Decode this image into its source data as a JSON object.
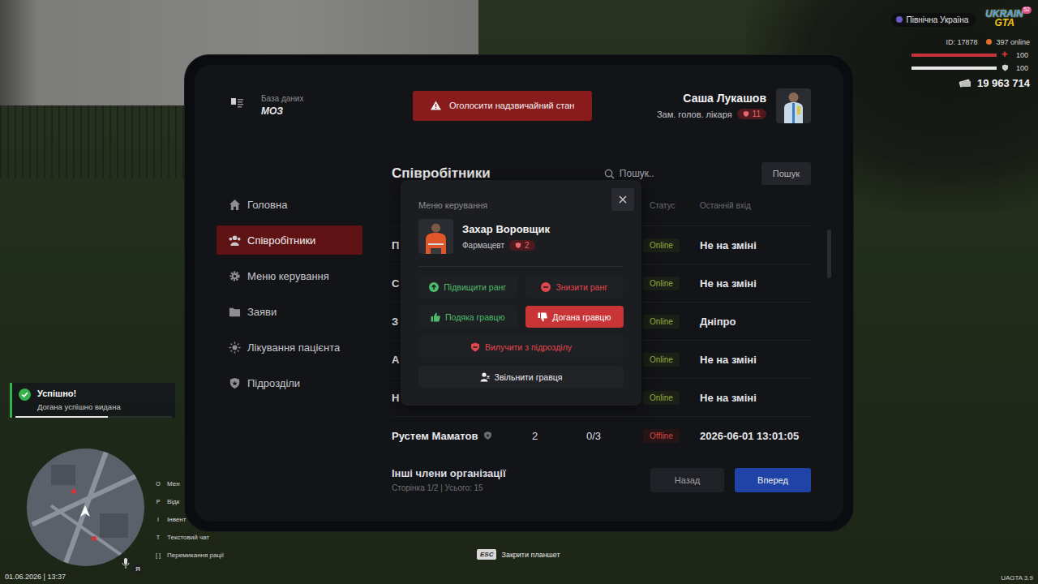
{
  "hud": {
    "region": "Північна Україна",
    "logo": {
      "top": "UKRAIN",
      "bottom": "GTA",
      "badge": "52"
    },
    "id": "ID: 17878",
    "online": "397 online",
    "health": {
      "value": "100",
      "level": 1
    },
    "armor": {
      "value": "100",
      "level": 1
    },
    "money": "19 963 714"
  },
  "tablet": {
    "brand": {
      "label": "База даних",
      "title": "МОЗ"
    },
    "emergency_button": "Оголосити надзвичайний стан",
    "user": {
      "name": "Саша Лукашов",
      "role": "Зам. голов. лікаря",
      "rank": "11"
    },
    "sidebar": {
      "items": [
        {
          "label": "Головна",
          "selected": false
        },
        {
          "label": "Співробітники",
          "selected": true
        },
        {
          "label": "Меню керування",
          "selected": false
        },
        {
          "label": "Заяви",
          "selected": false
        },
        {
          "label": "Лікування пацієнта",
          "selected": false
        },
        {
          "label": "Підрозділи",
          "selected": false
        }
      ]
    },
    "page": {
      "title": "Співробітники",
      "search": {
        "placeholder": "Пошук..",
        "button": "Пошук"
      }
    },
    "table": {
      "columns": [
        "Статус",
        "Останній вхід"
      ],
      "rows": [
        {
          "name": "П",
          "rank": "",
          "warnings": "",
          "status": "Online",
          "online": true,
          "last_login": "Не на зміні",
          "shield": false
        },
        {
          "name": "С",
          "rank": "",
          "warnings": "",
          "status": "Online",
          "online": true,
          "last_login": "Не на зміні",
          "shield": false
        },
        {
          "name": "З",
          "rank": "",
          "warnings": "",
          "status": "Online",
          "online": true,
          "last_login": "Дніпро",
          "shield": false
        },
        {
          "name": "А",
          "rank": "",
          "warnings": "",
          "status": "Online",
          "online": true,
          "last_login": "Не на зміні",
          "shield": false
        },
        {
          "name": "Н",
          "rank": "",
          "warnings": "",
          "status": "Online",
          "online": true,
          "last_login": "Не на зміні",
          "shield": false
        },
        {
          "name": "Рустем Маматов",
          "rank": "2",
          "warnings": "0/3",
          "status": "Offline",
          "online": false,
          "last_login": "2026-06-01 13:01:05",
          "shield": true
        }
      ]
    },
    "footer": {
      "title": "Інші члени організації",
      "subtitle": "Сторінка 1/2 | Усього: 15",
      "buttons": [
        {
          "label": "Назад",
          "primary": false
        },
        {
          "label": "Вперед",
          "primary": true
        }
      ]
    }
  },
  "modal": {
    "title": "Меню керування",
    "player": {
      "name": "Захар Воровщик",
      "role": "Фармацевт",
      "rank": "2"
    },
    "actions": [
      {
        "label": "Підвищити ранг",
        "tone": "positive",
        "hovered": false
      },
      {
        "label": "Знизити ранг",
        "tone": "negative",
        "hovered": false
      },
      {
        "label": "Подяка гравцю",
        "tone": "positive",
        "hovered": false
      },
      {
        "label": "Догана гравцю",
        "tone": "negative",
        "hovered": true
      },
      {
        "label": "Вилучити з підрозділу",
        "tone": "negative",
        "hovered": false
      },
      {
        "label": "Звільнити гравця",
        "tone": "neutral",
        "hovered": false
      }
    ]
  },
  "notification": {
    "title": "Успішно!",
    "message": "Догана успішно видана",
    "level": 0.59
  },
  "keybinds": [
    {
      "key": "O",
      "label": "Мен"
    },
    {
      "key": "P",
      "label": "Відк"
    },
    {
      "key": "I",
      "label": "Інвент"
    },
    {
      "key": "T",
      "label": "Текстовий чат"
    },
    {
      "key": "[ ]",
      "label": "Перемикання рації"
    }
  ],
  "status": {
    "datetime": "01.06.2026 | 13:37",
    "close_hint": {
      "key": "ESC",
      "label": "Закрити планшет"
    },
    "version": "UAGTA 3.9",
    "voice": "Я"
  }
}
